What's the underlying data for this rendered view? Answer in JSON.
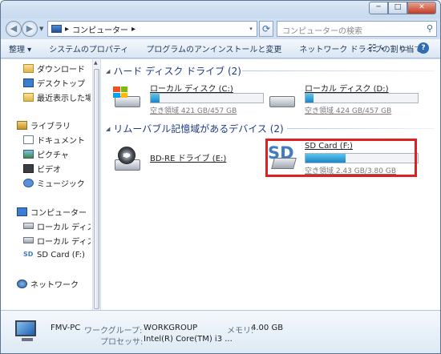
{
  "window": {
    "min": "─",
    "max": "□",
    "close": "✕"
  },
  "nav": {
    "back": "◀",
    "forward": "▶",
    "dropdown": "▼"
  },
  "address": {
    "segments": [
      "コンピューター"
    ],
    "sep": "▸",
    "dropdown": "▾"
  },
  "search": {
    "placeholder": "コンピューターの検索",
    "icon": "search-icon"
  },
  "commands": [
    "整理 ▾",
    "システムのプロパティ",
    "プログラムのアンインストールと変更",
    "ネットワーク ドライブの割り当て",
    "»"
  ],
  "toolbar": {
    "view": "☷",
    "view_dd": "▾",
    "pane": "▭",
    "help": "?"
  },
  "sidebar": {
    "favorites": [
      "ダウンロード",
      "デスクトップ",
      "最近表示した場所"
    ],
    "libraries": {
      "title": "ライブラリ",
      "items": [
        "ドキュメント",
        "ピクチャ",
        "ビデオ",
        "ミュージック"
      ]
    },
    "computer": {
      "title": "コンピューター",
      "items": [
        "ローカル ディスク (C:)",
        "ローカル ディスク (D:)",
        "SD Card (F:)"
      ]
    },
    "network": "ネットワーク"
  },
  "groups": {
    "hdd": {
      "title": "ハード ディスク ドライブ (2)",
      "toggle": "◢"
    },
    "removable": {
      "title": "リムーバブル記憶域があるデバイス (2)",
      "toggle": "◢"
    }
  },
  "drives": {
    "c": {
      "name": "ローカル ディスク (C:)",
      "free": "空き領域 421 GB/457 GB",
      "used_fraction": 0.08
    },
    "d": {
      "name": "ローカル ディスク (D:)",
      "free": "空き領域 424 GB/457 GB",
      "used_fraction": 0.07
    },
    "e": {
      "name": "BD-RE ドライブ (E:)",
      "icon_text": "BD"
    },
    "f": {
      "name": "SD Card (F:)",
      "free": "空き領域 2.43 GB/3.80 GB",
      "used_fraction": 0.36,
      "icon_text": "SD"
    }
  },
  "details": {
    "name": "FMV-PC",
    "workgroup_label": "ワークグループ:",
    "workgroup": "WORKGROUP",
    "memory_label": "メモリ:",
    "memory": "4.00 GB",
    "cpu_label": "プロセッサ:",
    "cpu": "Intel(R) Core(TM) i3 ..."
  },
  "colors": {
    "highlight": "#e02020",
    "bar": "#1a86c9",
    "group_title": "#1e3a8a"
  }
}
